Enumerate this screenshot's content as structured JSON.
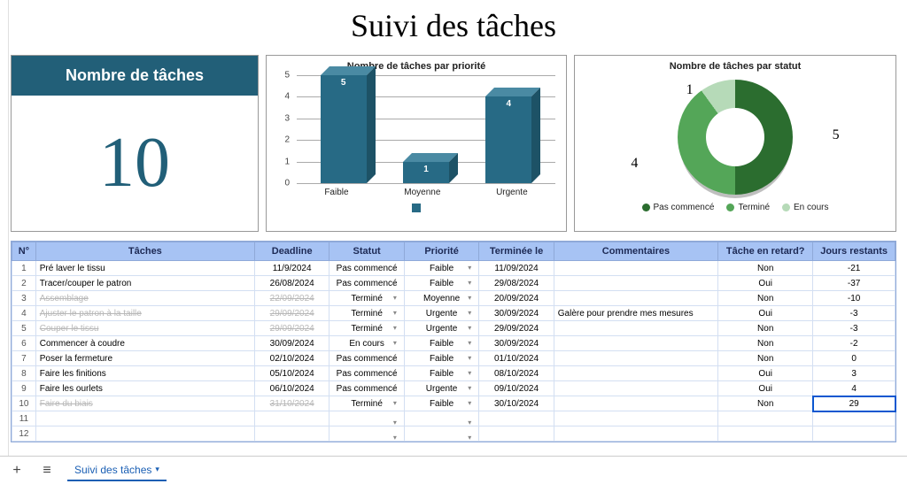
{
  "title": "Suivi des tâches",
  "kpi": {
    "label": "Nombre de tâches",
    "value": "10"
  },
  "chart_data": [
    {
      "type": "bar",
      "title": "Nombre de tâches par priorité",
      "categories": [
        "Faible",
        "Moyenne",
        "Urgente"
      ],
      "values": [
        5,
        1,
        4
      ],
      "ylim": [
        0,
        5
      ],
      "yticks": [
        "0",
        "1",
        "2",
        "3",
        "4",
        "5"
      ]
    },
    {
      "type": "pie",
      "title": "Nombre de tâches par statut",
      "series": [
        {
          "name": "Pas commencé",
          "value": 5
        },
        {
          "name": "Terminé",
          "value": 4
        },
        {
          "name": "En cours",
          "value": 1
        }
      ]
    }
  ],
  "table": {
    "headers": {
      "n": "N°",
      "task": "Tâches",
      "deadline": "Deadline",
      "status": "Statut",
      "priority": "Priorité",
      "finished": "Terminée le",
      "comments": "Commentaires",
      "late": "Tâche en retard?",
      "remaining": "Jours restants"
    },
    "rows": [
      {
        "n": "1",
        "task": "Pré laver le tissu",
        "deadline": "11/9/2024",
        "status": "Pas commencé",
        "priority": "Faible",
        "finished": "11/09/2024",
        "comments": "",
        "late": "Non",
        "remaining": "-21",
        "done": false
      },
      {
        "n": "2",
        "task": "Tracer/couper le patron",
        "deadline": "26/08/2024",
        "status": "Pas commencé",
        "priority": "Faible",
        "finished": "29/08/2024",
        "comments": "",
        "late": "Oui",
        "remaining": "-37",
        "done": false
      },
      {
        "n": "3",
        "task": "Assemblage",
        "deadline": "22/09/2024",
        "status": "Terminé",
        "priority": "Moyenne",
        "finished": "20/09/2024",
        "comments": "",
        "late": "Non",
        "remaining": "-10",
        "done": true
      },
      {
        "n": "4",
        "task": "Ajuster le patron à la taille",
        "deadline": "29/09/2024",
        "status": "Terminé",
        "priority": "Urgente",
        "finished": "30/09/2024",
        "comments": "Galère pour prendre mes mesures",
        "late": "Oui",
        "remaining": "-3",
        "done": true
      },
      {
        "n": "5",
        "task": "Couper le tissu",
        "deadline": "29/09/2024",
        "status": "Terminé",
        "priority": "Urgente",
        "finished": "29/09/2024",
        "comments": "",
        "late": "Non",
        "remaining": "-3",
        "done": true
      },
      {
        "n": "6",
        "task": "Commencer à coudre",
        "deadline": "30/09/2024",
        "status": "En cours",
        "priority": "Faible",
        "finished": "30/09/2024",
        "comments": "",
        "late": "Non",
        "remaining": "-2",
        "done": false
      },
      {
        "n": "7",
        "task": "Poser la fermeture",
        "deadline": "02/10/2024",
        "status": "Pas commencé",
        "priority": "Faible",
        "finished": "01/10/2024",
        "comments": "",
        "late": "Non",
        "remaining": "0",
        "done": false
      },
      {
        "n": "8",
        "task": "Faire les finitions",
        "deadline": "05/10/2024",
        "status": "Pas commencé",
        "priority": "Faible",
        "finished": "08/10/2024",
        "comments": "",
        "late": "Oui",
        "remaining": "3",
        "done": false
      },
      {
        "n": "9",
        "task": "Faire les ourlets",
        "deadline": "06/10/2024",
        "status": "Pas commencé",
        "priority": "Urgente",
        "finished": "09/10/2024",
        "comments": "",
        "late": "Oui",
        "remaining": "4",
        "done": false
      },
      {
        "n": "10",
        "task": "Faire du biais",
        "deadline": "31/10/2024",
        "status": "Terminé",
        "priority": "Faible",
        "finished": "30/10/2024",
        "comments": "",
        "late": "Non",
        "remaining": "29",
        "done": true
      },
      {
        "n": "11",
        "task": "",
        "deadline": "",
        "status": "",
        "priority": "",
        "finished": "",
        "comments": "",
        "late": "",
        "remaining": "",
        "done": false
      },
      {
        "n": "12",
        "task": "",
        "deadline": "",
        "status": "",
        "priority": "",
        "finished": "",
        "comments": "",
        "late": "",
        "remaining": "",
        "done": false
      }
    ]
  },
  "sheet_tab": "Suivi des tâches"
}
